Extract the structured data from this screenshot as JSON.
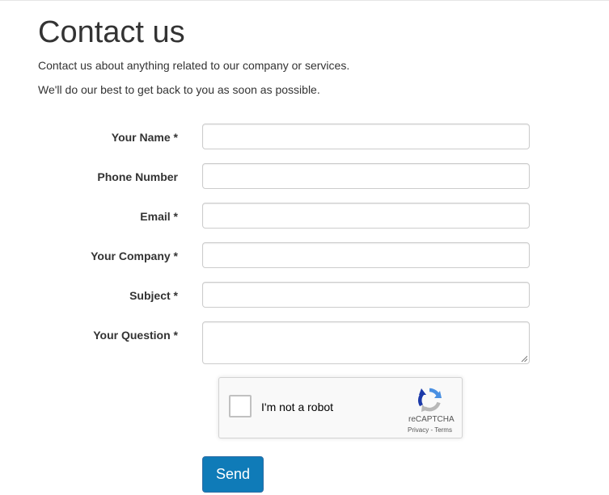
{
  "page": {
    "title": "Contact us",
    "intro_line_1": "Contact us about anything related to our company or services.",
    "intro_line_2": "We'll do our best to get back to you as soon as possible."
  },
  "form": {
    "fields": [
      {
        "label": "Your Name *",
        "value": "",
        "type": "text"
      },
      {
        "label": "Phone Number",
        "value": "",
        "type": "text"
      },
      {
        "label": "Email *",
        "value": "",
        "type": "text"
      },
      {
        "label": "Your Company *",
        "value": "",
        "type": "text"
      },
      {
        "label": "Subject *",
        "value": "",
        "type": "text"
      },
      {
        "label": "Your Question *",
        "value": "",
        "type": "textarea"
      }
    ],
    "captcha": {
      "label": "I'm not a robot",
      "brand": "reCAPTCHA",
      "links": "Privacy - Terms",
      "icon": "recaptcha-logo-icon"
    },
    "submit_label": "Send"
  },
  "colors": {
    "button_bg": "#0f7bb8",
    "text": "#333333",
    "border": "#cccccc",
    "recaptcha_blue": "#4a90e2",
    "recaptcha_gray": "#b7b7b7"
  }
}
